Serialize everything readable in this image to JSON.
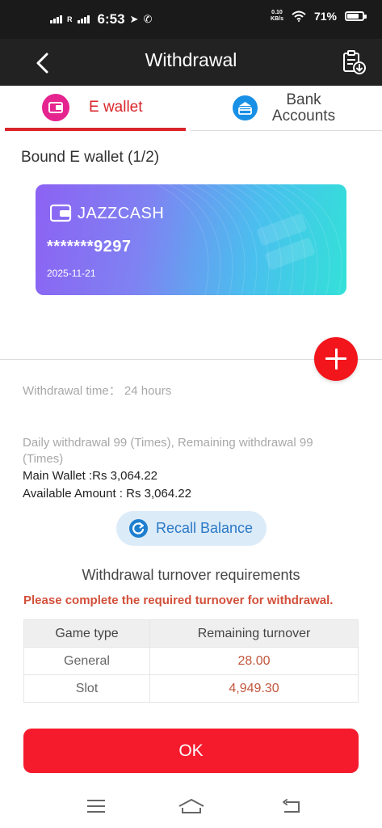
{
  "status_bar": {
    "carrier_mark": "R",
    "time": "6:53",
    "net_speed_value": "0.10",
    "net_speed_unit": "KB/s",
    "battery": "71%",
    "battery_level": 0.71
  },
  "header": {
    "title": "Withdrawal",
    "back_icon": "chevron-left-icon",
    "record_icon": "clipboard-download-icon"
  },
  "tabs": [
    {
      "label": "E wallet",
      "icon": "wallet-icon",
      "active": true
    },
    {
      "label_line1": "Bank",
      "label_line2": "Accounts",
      "icon": "bank-card-icon",
      "active": false
    }
  ],
  "bound_section": {
    "title": "Bound E wallet (1/2)"
  },
  "card": {
    "name": "JAZZCASH",
    "number": "*******9297",
    "date": "2025-11-21"
  },
  "info": {
    "withdrawal_time_label": "Withdrawal time：",
    "withdrawal_time_value": "24 hours",
    "daily_withdrawal": "Daily withdrawal 99 (Times), Remaining withdrawal 99 (Times)",
    "main_wallet": "Main Wallet :Rs 3,064.22",
    "available_amount": "Available Amount : Rs 3,064.22"
  },
  "recall": {
    "label": "Recall Balance",
    "icon": "refresh-icon"
  },
  "turnover": {
    "title": "Withdrawal turnover requirements",
    "warning": "Please complete the required turnover for withdrawal.",
    "columns": [
      "Game type",
      "Remaining turnover"
    ],
    "rows": [
      {
        "type": "General",
        "value": "28.00"
      },
      {
        "type": "Slot",
        "value": "4,949.30"
      }
    ]
  },
  "ok_button": {
    "label": "OK"
  },
  "colors": {
    "accent_red": "#f51a2c",
    "tab_active": "#d9252b",
    "header_bg": "#222222",
    "wallet_pink": "#e5248f",
    "bank_blue": "#1890e6",
    "recall_blue": "#2a79c7",
    "warning_text": "#d2503a"
  },
  "system_nav": {
    "icons": [
      "menu-icon",
      "home-icon",
      "back-return-icon"
    ]
  }
}
